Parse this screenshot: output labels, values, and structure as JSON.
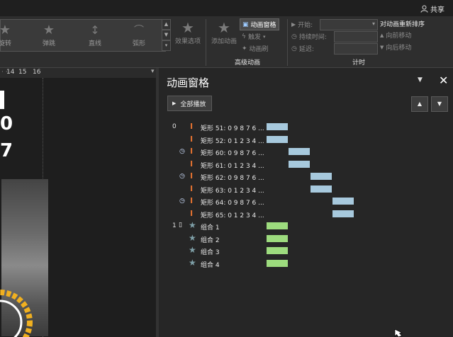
{
  "topbar": {
    "share_label": "共享"
  },
  "ribbon": {
    "gallery_items": [
      {
        "label": "旋转",
        "icon": "star-spin-icon"
      },
      {
        "label": "弹跳",
        "icon": "star-bounce-icon"
      },
      {
        "label": "直线",
        "icon": "line-path-icon"
      },
      {
        "label": "弧形",
        "icon": "arc-path-icon"
      }
    ],
    "effect_options": "效果选项",
    "add_animation": "添加动画",
    "animation_pane": "动画窗格",
    "trigger": "触发",
    "animation_painter": "动画刷",
    "advanced_group": "高级动画",
    "start_label": "开始:",
    "duration_label": "持续时间:",
    "delay_label": "延迟:",
    "timing_group": "计时",
    "reorder_title": "对动画重新排序",
    "move_earlier": "向前移动",
    "move_later": "向后移动"
  },
  "ruler": {
    "marks": [
      "14",
      "15",
      "16"
    ]
  },
  "slide_digits": [
    "0",
    "7"
  ],
  "pane": {
    "title": "动画窗格",
    "play_all": "全部播放",
    "rows": [
      {
        "num": "0",
        "clock": false,
        "mouse": false,
        "type": "motion",
        "label": "矩形 51: 0 9 8 7 6 ...",
        "bar_start": 0,
        "bar_end": 30,
        "bar_color": "#a7c9dd"
      },
      {
        "num": "",
        "clock": false,
        "mouse": false,
        "type": "motion",
        "label": "矩形 52: 0 1 2 3 4 ...",
        "bar_start": 0,
        "bar_end": 30,
        "bar_color": "#a7c9dd"
      },
      {
        "num": "",
        "clock": true,
        "mouse": false,
        "type": "motion",
        "label": "矩形 60: 0 9 8 7 6 ...",
        "bar_start": 31,
        "bar_end": 61,
        "bar_color": "#a7c9dd"
      },
      {
        "num": "",
        "clock": false,
        "mouse": false,
        "type": "motion",
        "label": "矩形 61: 0 1 2 3 4 ...",
        "bar_start": 31,
        "bar_end": 61,
        "bar_color": "#a7c9dd"
      },
      {
        "num": "",
        "clock": true,
        "mouse": false,
        "type": "motion",
        "label": "矩形 62: 0 9 8 7 6 ...",
        "bar_start": 62,
        "bar_end": 92,
        "bar_color": "#a7c9dd"
      },
      {
        "num": "",
        "clock": false,
        "mouse": false,
        "type": "motion",
        "label": "矩形 63: 0 1 2 3 4 ...",
        "bar_start": 62,
        "bar_end": 92,
        "bar_color": "#a7c9dd"
      },
      {
        "num": "",
        "clock": true,
        "mouse": false,
        "type": "motion",
        "label": "矩形 64: 0 9 8 7 6 ...",
        "bar_start": 93,
        "bar_end": 123,
        "bar_color": "#a7c9dd"
      },
      {
        "num": "",
        "clock": false,
        "mouse": false,
        "type": "motion",
        "label": "矩形 65: 0 1 2 3 4 ...",
        "bar_start": 93,
        "bar_end": 123,
        "bar_color": "#a7c9dd"
      },
      {
        "num": "1",
        "clock": false,
        "mouse": true,
        "type": "entrance",
        "label": "组合 1",
        "bar_start": 0,
        "bar_end": 30,
        "bar_color": "#9ddb7e"
      },
      {
        "num": "",
        "clock": false,
        "mouse": false,
        "type": "entrance",
        "label": "组合 2",
        "bar_start": 0,
        "bar_end": 30,
        "bar_color": "#9ddb7e"
      },
      {
        "num": "",
        "clock": false,
        "mouse": false,
        "type": "entrance",
        "label": "组合 3",
        "bar_start": 0,
        "bar_end": 30,
        "bar_color": "#9ddb7e"
      },
      {
        "num": "",
        "clock": false,
        "mouse": false,
        "type": "entrance",
        "label": "组合 4",
        "bar_start": 0,
        "bar_end": 30,
        "bar_color": "#9ddb7e"
      }
    ]
  }
}
